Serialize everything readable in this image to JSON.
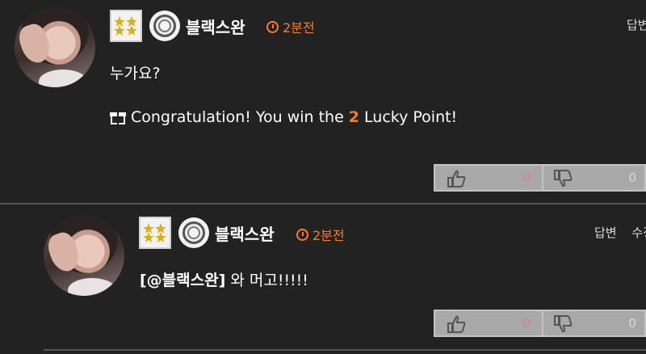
{
  "comments": [
    {
      "username": "블랙스완",
      "time": "2분전",
      "actions": [
        "답변"
      ],
      "text": "누가요?",
      "lucky": {
        "prefix": "Congratulation! You win the",
        "points": "2",
        "suffix": "Lucky Point!"
      },
      "votes": {
        "up": "0",
        "down": "0"
      }
    },
    {
      "username": "블랙스완",
      "time": "2분전",
      "actions": [
        "답변",
        "수정"
      ],
      "mention": "[@블랙스완]",
      "text": "와 머고!!!!!",
      "votes": {
        "up": "0",
        "down": "0"
      }
    }
  ],
  "colors": {
    "background": "#222222",
    "accent": "#ff7b2b",
    "vote_bar": "#a8a8a8"
  },
  "icons": [
    "rank-badge-icon",
    "level-badge-icon",
    "clock-icon",
    "gift-icon",
    "thumbs-up-icon",
    "thumbs-down-icon"
  ]
}
